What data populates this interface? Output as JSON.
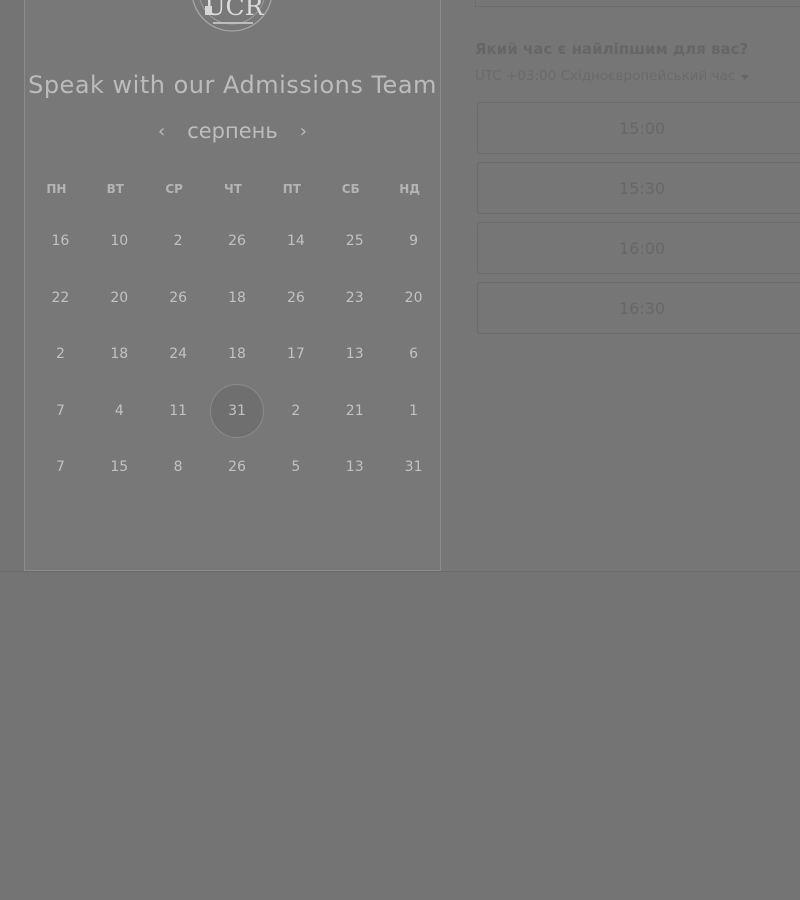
{
  "calendar": {
    "logo_text": "UCR",
    "title": "Speak with our Admissions Team",
    "month": "серпень",
    "prev_icon": "chevron-left-icon",
    "next_icon": "chevron-right-icon",
    "weekdays": [
      "ПН",
      "ВТ",
      "СР",
      "ЧТ",
      "ПТ",
      "СБ",
      "НД"
    ],
    "weeks": [
      [
        "16",
        "10",
        "2",
        "26",
        "14",
        "25",
        "9"
      ],
      [
        "22",
        "20",
        "26",
        "18",
        "26",
        "23",
        "20"
      ],
      [
        "2",
        "18",
        "24",
        "18",
        "17",
        "13",
        "6"
      ],
      [
        "7",
        "4",
        "11",
        "31",
        "2",
        "21",
        "1"
      ],
      [
        "7",
        "15",
        "8",
        "26",
        "5",
        "13",
        "31"
      ]
    ],
    "selected": "31"
  },
  "scheduler": {
    "question": "Який час є найліпшим для вас?",
    "timezone": "UTC +03:00 Східноєвропейський час",
    "slots": [
      "15:00",
      "15:30",
      "16:00",
      "16:30"
    ]
  }
}
